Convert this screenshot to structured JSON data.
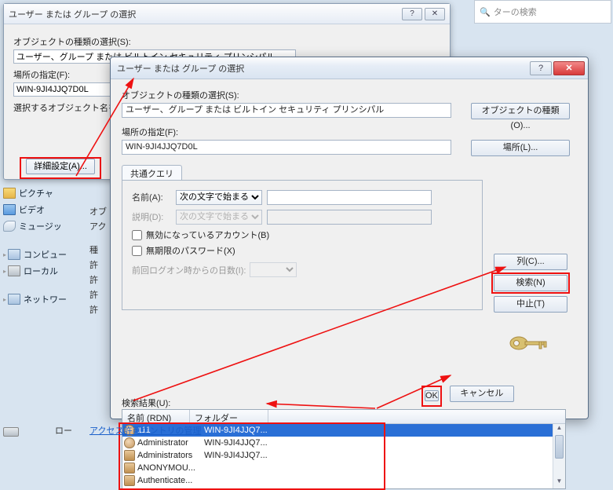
{
  "back": {
    "title": "ユーザー または グループ の選択",
    "help": "?",
    "close": "✕",
    "obj_label": "オブジェクトの種類の選択(S):",
    "obj_value": "ユーザー、グループ または ビルトイン セキュリティ プリンシパル",
    "obj_button": "オブジェクトの種類(O)...",
    "loc_label": "場所の指定(F):",
    "loc_value": "WIN-9JI4JJQ7D0L",
    "name_label": "選択するオブジェクト名を",
    "advanced": "詳細設定(A)..."
  },
  "right_search_placeholder": "ターの検索",
  "sidebar": {
    "pictures": "ピクチャ",
    "video": "ビデオ",
    "music": "ミュージッ",
    "computer": "コンピュー",
    "localdisk": "ローカル",
    "network": "ネットワー",
    "localdisk2": "ロー"
  },
  "mid": {
    "obj": "オブ",
    "acc": "アク",
    "type": "種",
    "perm1": "許",
    "perm2": "許",
    "perm3": "許",
    "perm4": "許"
  },
  "dialog": {
    "title": "ユーザー または グループ の選択",
    "help": "?",
    "close": "✕",
    "obj_label": "オブジェクトの種類の選択(S):",
    "obj_value": "ユーザー、グループ または ビルトイン セキュリティ プリンシパル",
    "obj_button": "オブジェクトの種類(O)...",
    "loc_label": "場所の指定(F):",
    "loc_value": "WIN-9JI4JJQ7D0L",
    "loc_button": "場所(L)...",
    "tab": "共通クエリ",
    "name_lbl": "名前(A):",
    "desc_lbl": "説明(D):",
    "starts_with": "次の文字で始まる",
    "chk_disabled": "無効になっているアカウント(B)",
    "chk_noexpire": "無期限のパスワード(X)",
    "days_lbl": "前回ログオン時からの日数(I):",
    "btn_columns": "列(C)...",
    "btn_search": "検索(N)",
    "btn_stop": "中止(T)",
    "btn_ok": "OK",
    "btn_cancel": "キャンセル",
    "results_lbl": "検索結果(U):",
    "col_name": "名前 (RDN)",
    "col_folder": "フォルダー",
    "rows": [
      {
        "name": "111",
        "folder": "WIN-9JI4JJQ7...",
        "type": "user",
        "selected": true
      },
      {
        "name": "Administrator",
        "folder": "WIN-9JI4JJQ7...",
        "type": "user",
        "selected": false
      },
      {
        "name": "Administrators",
        "folder": "WIN-9JI4JJQ7...",
        "type": "group",
        "selected": false
      },
      {
        "name": "ANONYMOU...",
        "folder": "",
        "type": "group",
        "selected": false
      },
      {
        "name": "Authenticate...",
        "folder": "",
        "type": "group",
        "selected": false
      }
    ]
  },
  "bottom_link": "アクセス許可エントリの管理"
}
